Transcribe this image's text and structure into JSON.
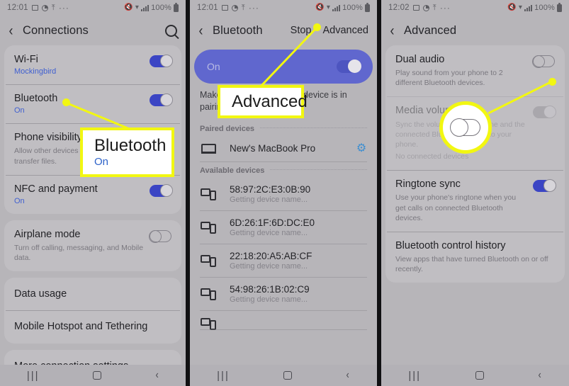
{
  "panels": [
    {
      "id": "connections",
      "statusbar": {
        "time": "12:01",
        "battery": "100%"
      },
      "titlebar": {
        "title": "Connections",
        "back_icon": "chevron-left-icon",
        "search_icon": "search-icon"
      },
      "groups": [
        {
          "rows": [
            {
              "title": "Wi-Fi",
              "sub": "Mockingbird",
              "sub_style": "link",
              "toggle": "on"
            },
            {
              "title": "Bluetooth",
              "sub": "On",
              "sub_style": "link",
              "toggle": "on"
            },
            {
              "title": "Phone visibility",
              "desc": "Allow other devices to find your phone and transfer files.",
              "toggle": "none"
            },
            {
              "title": "NFC and payment",
              "sub": "On",
              "sub_style": "link",
              "toggle": "on"
            }
          ]
        },
        {
          "rows": [
            {
              "title": "Airplane mode",
              "desc": "Turn off calling, messaging, and Mobile data.",
              "toggle": "off"
            }
          ]
        },
        {
          "rows": [
            {
              "title": "Data usage",
              "toggle": "none"
            },
            {
              "title": "Mobile Hotspot and Tethering",
              "toggle": "none"
            }
          ]
        },
        {
          "rows": [
            {
              "title": "More connection settings",
              "toggle": "none"
            }
          ]
        }
      ]
    },
    {
      "id": "bluetooth",
      "statusbar": {
        "time": "12:01",
        "battery": "100%"
      },
      "titlebar": {
        "title": "Bluetooth",
        "back_icon": "chevron-left-icon",
        "actions": [
          "Stop",
          "Advanced"
        ]
      },
      "banner": {
        "label": "On",
        "toggle": "on"
      },
      "note": "Make sure your Bluetooth device is in pairing mode to connect.",
      "sections": [
        {
          "header": "Paired devices",
          "devices": [
            {
              "name": "New's MacBook Pro",
              "status": "",
              "icon": "laptop-icon",
              "gear": true
            }
          ]
        },
        {
          "header": "Available devices",
          "devices": [
            {
              "name": "58:97:2C:E3:0B:90",
              "status": "Getting device name...",
              "icon": "two-devices-icon",
              "gear": false
            },
            {
              "name": "6D:26:1F:6D:DC:E0",
              "status": "Getting device name...",
              "icon": "two-devices-icon",
              "gear": false
            },
            {
              "name": "22:18:20:A5:AB:CF",
              "status": "Getting device name...",
              "icon": "two-devices-icon",
              "gear": false
            },
            {
              "name": "54:98:26:1B:02:C9",
              "status": "Getting device name...",
              "icon": "two-devices-icon",
              "gear": false
            }
          ]
        }
      ]
    },
    {
      "id": "advanced",
      "statusbar": {
        "time": "12:02",
        "battery": "100%"
      },
      "titlebar": {
        "title": "Advanced",
        "back_icon": "chevron-left-icon"
      },
      "groups": [
        {
          "rows": [
            {
              "title": "Dual audio",
              "desc": "Play sound from your phone to 2 different Bluetooth devices.",
              "toggle": "off"
            },
            {
              "title": "Media volume sync",
              "desc": "Sync the volume of your phone and the connected Bluetooth device to your phone.",
              "desc2": "No connected devices",
              "toggle": "disabled-on",
              "dim": true
            },
            {
              "title": "Ringtone sync",
              "desc": "Use your phone's ringtone when you get calls on connected Bluetooth devices.",
              "toggle": "on"
            },
            {
              "title": "Bluetooth control history",
              "desc": "View apps that have turned Bluetooth on or off recently.",
              "toggle": "none"
            }
          ]
        }
      ]
    }
  ],
  "navbar": {
    "recent": "|||",
    "home_icon": "home-square-icon",
    "back_icon": "chevron-left-icon"
  },
  "annotations": {
    "highlight_color": "#f2f711",
    "callout_bluetooth": {
      "title": "Bluetooth",
      "sub": "On"
    },
    "callout_advanced": {
      "title": "Advanced"
    },
    "magnifier": {
      "target": "media-volume-sync-toggle",
      "state": "off"
    }
  }
}
